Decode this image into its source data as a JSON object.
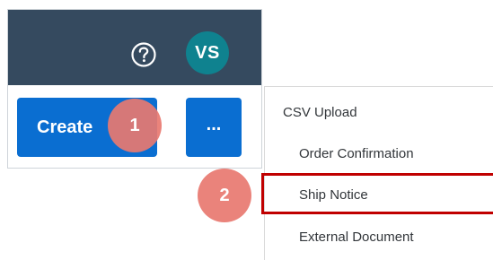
{
  "header": {
    "help_icon": "question-circle-icon",
    "avatar_initials": "VS",
    "colors": {
      "header_bg": "#354a5f",
      "avatar_bg": "#0f828f"
    }
  },
  "toolbar": {
    "create_label": "Create",
    "more_label": "...",
    "accent_color": "#0a6ed1"
  },
  "menu": {
    "items": [
      {
        "label": "CSV Upload",
        "type": "group"
      },
      {
        "label": "Order Confirmation",
        "type": "sub"
      },
      {
        "label": "Ship Notice",
        "type": "sub",
        "highlighted": true
      },
      {
        "label": "External Document",
        "type": "sub"
      }
    ],
    "highlight_color": "#c00000"
  },
  "annotations": {
    "steps": [
      "1",
      "2"
    ],
    "marker_color": "#e87870"
  }
}
